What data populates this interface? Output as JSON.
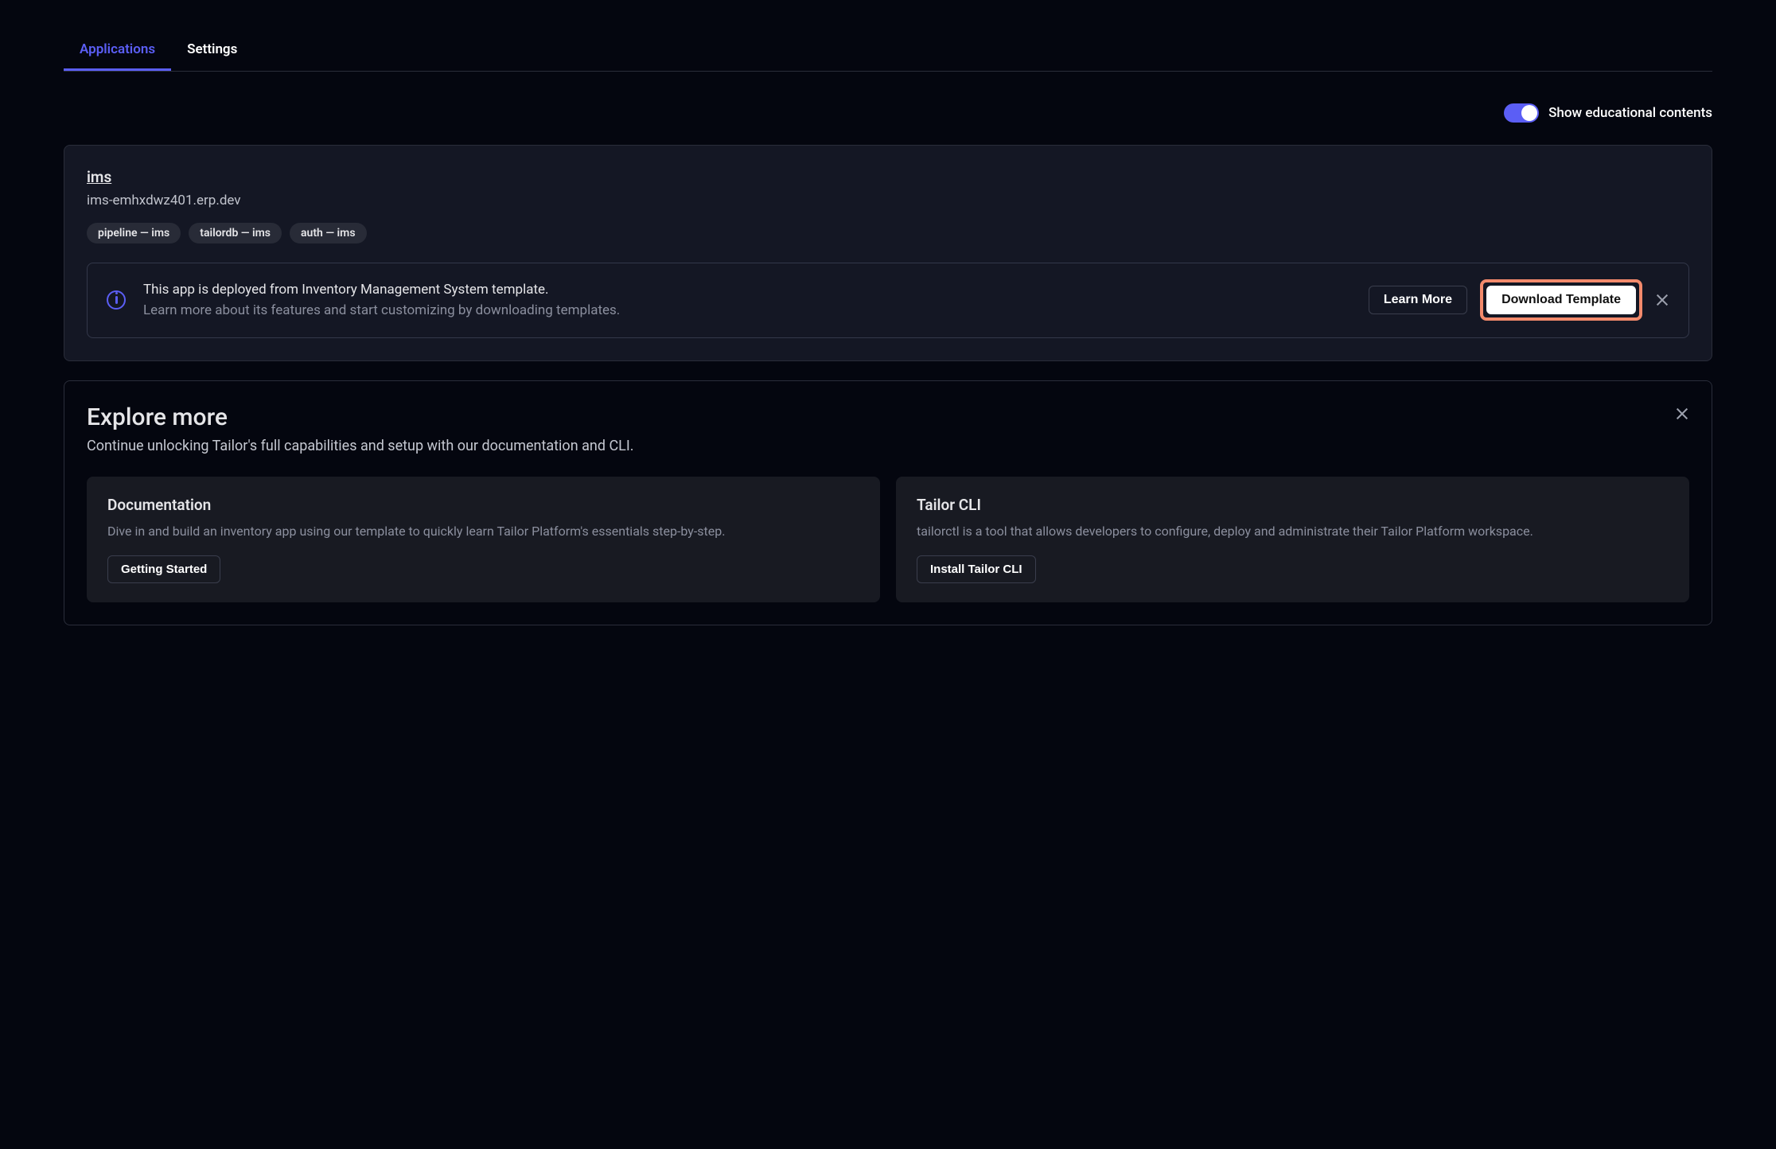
{
  "tabs": [
    {
      "label": "Applications",
      "active": true
    },
    {
      "label": "Settings",
      "active": false
    }
  ],
  "toggle": {
    "label": "Show educational contents",
    "on": true
  },
  "app": {
    "name": "ims",
    "url": "ims-emhxdwz401.erp.dev",
    "chips": [
      "pipeline — ims",
      "tailordb — ims",
      "auth — ims"
    ],
    "banner": {
      "line1": "This app is deployed from Inventory Management System template.",
      "line2": "Learn more about its features and start customizing by downloading templates.",
      "learn_more": "Learn More",
      "download": "Download Template"
    }
  },
  "explore": {
    "title": "Explore more",
    "subtitle": "Continue unlocking Tailor's full capabilities and setup with our documentation and CLI.",
    "cards": [
      {
        "title": "Documentation",
        "desc": "Dive in and build an inventory app using our template to quickly learn Tailor Platform's essentials step-by-step.",
        "cta": "Getting Started"
      },
      {
        "title": "Tailor CLI",
        "desc": "tailorctl is a tool that allows developers to configure, deploy and administrate their Tailor Platform workspace.",
        "cta": "Install Tailor CLI"
      }
    ]
  }
}
